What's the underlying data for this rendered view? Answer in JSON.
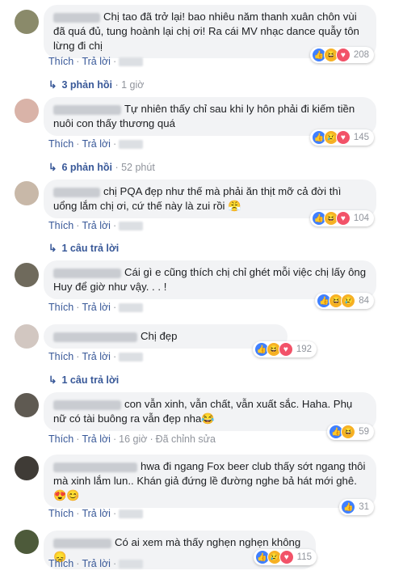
{
  "labels": {
    "like": "Thích",
    "reply": "Trả lời",
    "edited": "Đã chỉnh sửa"
  },
  "comments": [
    {
      "text": "Chị tao đã trở lại! bao nhiêu năm thanh xuân chôn vùi đã quá đủ, tung hoành lại chị ơi! Ra cái MV nhạc dance quẫy tôn lừng đi chị",
      "count": "208",
      "reply_summary": "3 phản hồi",
      "reply_time": "1 giờ"
    },
    {
      "text": "Tự nhiên thấy chỉ sau khi ly hôn phải đi kiếm tiền nuôi con thấy thương quá",
      "count": "145",
      "reply_summary": "6 phản hồi",
      "reply_time": "52 phút"
    },
    {
      "text": "chị PQA đẹp như thế mà phải ăn thịt mỡ cả đời thì uổng lắm chị ơi, cứ thế này là zui rồi 😤",
      "count": "104",
      "reply_summary": "1 câu trả lời"
    },
    {
      "text": "Cái gì e cũng thích chị chỉ ghét mỗi việc chị lấy ông Huy để giờ như vậy. . . !",
      "count": "84"
    },
    {
      "text": "Chị đẹp",
      "count": "192",
      "reply_summary": "1 câu trả lời"
    },
    {
      "text": "con vẫn xinh, vẫn chất, vẫn xuất sắc. Haha. Phụ nữ có tài buông ra vẫn đẹp nha😂",
      "count": "59",
      "time": "16 giờ"
    },
    {
      "text": "hwa đi ngang Fox beer club thấy sớt ngang thôi mà xinh lắm lun.. Khán giả đứng lề đường nghe bả hát mới ghê.😍😊",
      "count": "31"
    },
    {
      "text": "Có ai xem mà thấy nghẹn nghẹn không 😞",
      "count": "115"
    }
  ]
}
